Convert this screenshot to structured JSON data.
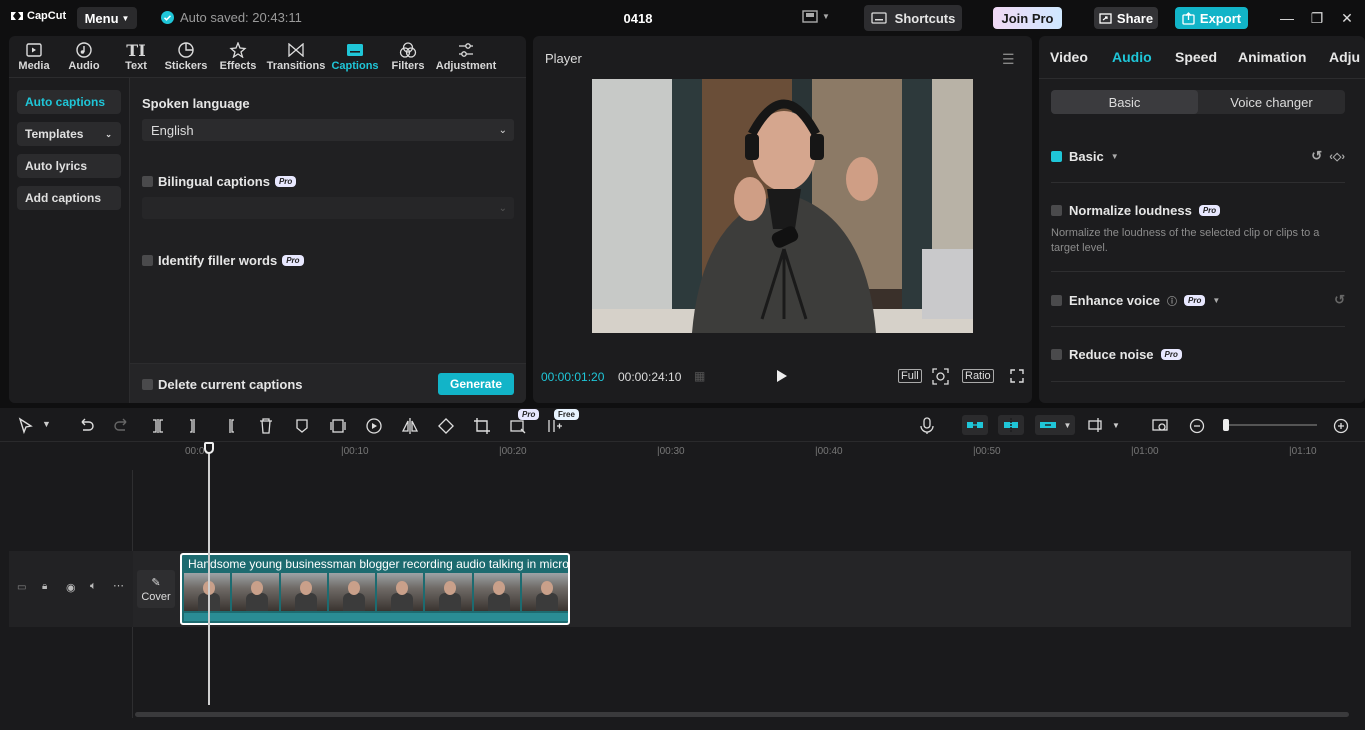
{
  "app": {
    "logo_text": "CapCut",
    "menu_label": "Menu",
    "autosave_text": "Auto saved: 20:43:11",
    "project_title": "0418",
    "shortcuts_label": "Shortcuts",
    "join_pro_label": "Join Pro",
    "share_label": "Share",
    "export_label": "Export"
  },
  "colors": {
    "accent": "#1fc6d8",
    "export_bg": "#12b4c8"
  },
  "tabs": [
    {
      "label": "Media",
      "icon": "media-icon"
    },
    {
      "label": "Audio",
      "icon": "audio-icon"
    },
    {
      "label": "Text",
      "icon": "text-icon"
    },
    {
      "label": "Stickers",
      "icon": "stickers-icon"
    },
    {
      "label": "Effects",
      "icon": "effects-icon"
    },
    {
      "label": "Transitions",
      "icon": "transitions-icon"
    },
    {
      "label": "Captions",
      "icon": "captions-icon",
      "active": true
    },
    {
      "label": "Filters",
      "icon": "filters-icon"
    },
    {
      "label": "Adjustment",
      "icon": "adjustment-icon"
    }
  ],
  "sidenav": [
    "Auto captions",
    "Templates",
    "Auto lyrics",
    "Add captions"
  ],
  "captions": {
    "spoken_language_label": "Spoken language",
    "language_value": "English",
    "bilingual_label": "Bilingual captions",
    "filler_label": "Identify filler words",
    "pro_badge": "Pro",
    "delete_label": "Delete current captions",
    "generate_label": "Generate"
  },
  "player": {
    "title": "Player",
    "current_time": "00:00:01:20",
    "total_time": "00:00:24:10",
    "full_label": "Full",
    "ratio_label": "Ratio"
  },
  "right": {
    "tabs": [
      "Video",
      "Audio",
      "Speed",
      "Animation",
      "Adju"
    ],
    "active_tab": "Audio",
    "segments": [
      "Basic",
      "Voice changer"
    ],
    "basic_label": "Basic",
    "normalize_label": "Normalize loudness",
    "normalize_desc": "Normalize the loudness of the selected clip or clips to a target level.",
    "enhance_label": "Enhance voice",
    "reduce_label": "Reduce noise",
    "pro_badge": "Pro"
  },
  "timeline": {
    "ticks": [
      "00:00",
      "|00:10",
      "|00:20",
      "|00:30",
      "|00:40",
      "|00:50",
      "|01:00",
      "|01:10"
    ],
    "pro_tag": "Pro",
    "free_tag": "Free",
    "cover_label": "Cover",
    "clip_title": "Handsome young businessman blogger recording audio talking in micro"
  }
}
